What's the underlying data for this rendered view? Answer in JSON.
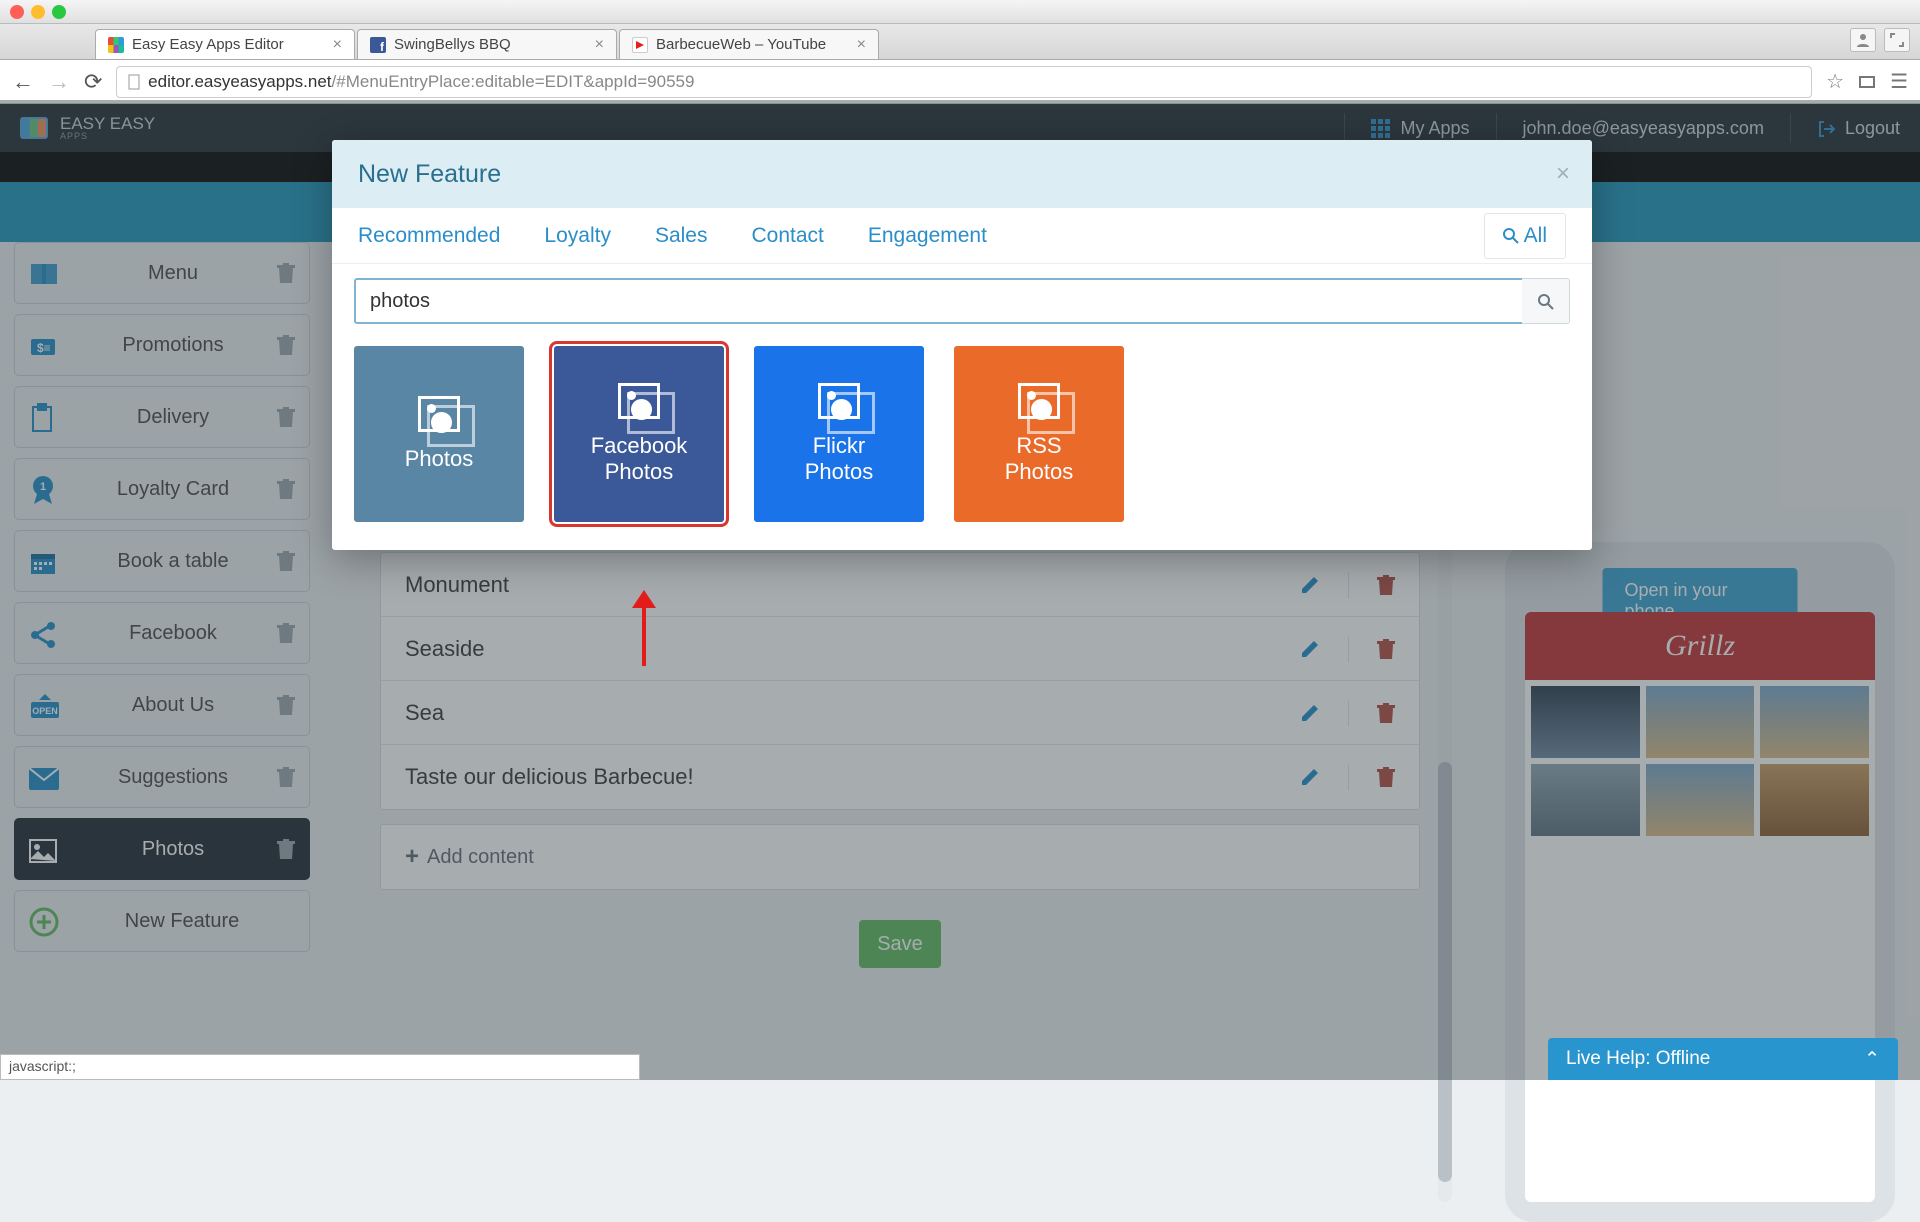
{
  "browser": {
    "tabs": [
      {
        "title": "Easy Easy Apps Editor",
        "favicon": "fav-grid",
        "active": true
      },
      {
        "title": "SwingBellys BBQ",
        "favicon": "fav-fb",
        "active": false
      },
      {
        "title": "BarbecueWeb – YouTube",
        "favicon": "fav-yt",
        "active": false
      }
    ],
    "url_host": "editor.easyeasyapps.net",
    "url_path": "/#MenuEntryPlace:editable=EDIT&appId=90559"
  },
  "header": {
    "brand_top": "EASY EASY",
    "brand_sub": "APPS",
    "my_apps": "My Apps",
    "user_email": "john.doe@easyeasyapps.com",
    "logout": "Logout"
  },
  "sidebar": {
    "items": [
      {
        "label": "Menu",
        "icon": "book-icon"
      },
      {
        "label": "Promotions",
        "icon": "dollar-tag-icon"
      },
      {
        "label": "Delivery",
        "icon": "clipboard-icon"
      },
      {
        "label": "Loyalty Card",
        "icon": "badge-icon"
      },
      {
        "label": "Book a table",
        "icon": "calendar-icon"
      },
      {
        "label": "Facebook",
        "icon": "share-icon"
      },
      {
        "label": "About Us",
        "icon": "open-sign-icon"
      },
      {
        "label": "Suggestions",
        "icon": "mail-icon"
      },
      {
        "label": "Photos",
        "icon": "photo-icon",
        "active": true
      }
    ],
    "new_feature": "New Feature"
  },
  "content": {
    "rows": [
      "Monument",
      "Seaside",
      "Sea",
      "Taste our delicious Barbecue!"
    ],
    "add_label": "Add content",
    "save_label": "Save"
  },
  "phone": {
    "open_label": "Open in your phone",
    "app_title": "Grillz"
  },
  "modal": {
    "title": "New Feature",
    "tabs": [
      "Recommended",
      "Loyalty",
      "Sales",
      "Contact",
      "Engagement"
    ],
    "all_label": "All",
    "search_value": "photos",
    "cards": [
      {
        "label": "Photos",
        "class": "card1"
      },
      {
        "label": "Facebook Photos",
        "class": "card2"
      },
      {
        "label": "Flickr Photos",
        "class": "card3"
      },
      {
        "label": "RSS Photos",
        "class": "card4"
      }
    ]
  },
  "status_bar": "javascript:;",
  "livehelp": {
    "label": "Live Help: Offline"
  }
}
